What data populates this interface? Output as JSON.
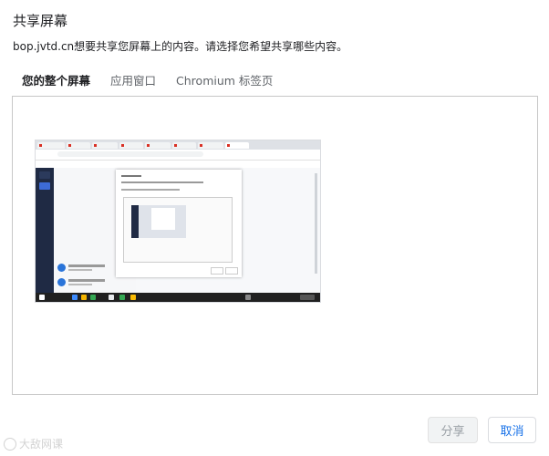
{
  "dialog": {
    "title": "共享屏幕",
    "description": "bop.jvtd.cn想要共享您屏幕上的内容。请选择您希望共享哪些内容。"
  },
  "tabs": [
    {
      "label": "您的整个屏幕",
      "active": true
    },
    {
      "label": "应用窗口",
      "active": false
    },
    {
      "label": "Chromium 标签页",
      "active": false
    }
  ],
  "buttons": {
    "share_label": "分享",
    "cancel_label": "取消"
  },
  "watermark": {
    "text": "大敌网课"
  },
  "colors": {
    "accent": "#1a73e8",
    "sidebar_dark": "#1f2a44",
    "disabled_text": "#9aa0a6"
  }
}
